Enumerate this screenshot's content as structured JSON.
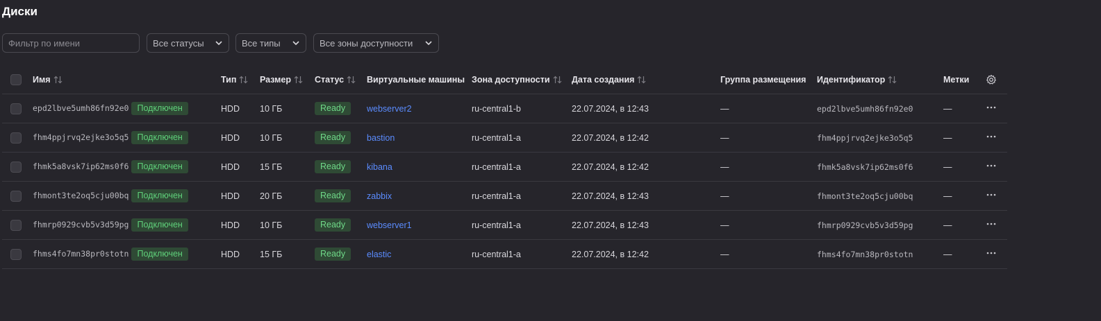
{
  "page": {
    "title": "Диски"
  },
  "filters": {
    "name_placeholder": "Фильтр по имени",
    "status_select": "Все статусы",
    "type_select": "Все типы",
    "zone_select": "Все зоны доступности"
  },
  "table": {
    "columns": {
      "name": "Имя",
      "type": "Тип",
      "size": "Размер",
      "status": "Статус",
      "vms": "Виртуальные машины",
      "zone": "Зона доступности",
      "created": "Дата создания",
      "placement": "Группа размещения",
      "id": "Идентификатор",
      "labels": "Метки"
    },
    "rows": [
      {
        "name": "epd2lbve5umh86fn92e0",
        "attach": "Подключен",
        "type": "HDD",
        "size": "10 ГБ",
        "status": "Ready",
        "vm": "webserver2",
        "zone": "ru-central1-b",
        "created": "22.07.2024, в 12:43",
        "placement": "—",
        "id": "epd2lbve5umh86fn92e0",
        "labels": "—"
      },
      {
        "name": "fhm4ppjrvq2ejke3o5q5",
        "attach": "Подключен",
        "type": "HDD",
        "size": "10 ГБ",
        "status": "Ready",
        "vm": "bastion",
        "zone": "ru-central1-a",
        "created": "22.07.2024, в 12:42",
        "placement": "—",
        "id": "fhm4ppjrvq2ejke3o5q5",
        "labels": "—"
      },
      {
        "name": "fhmk5a8vsk7ip62ms0f6",
        "attach": "Подключен",
        "type": "HDD",
        "size": "15 ГБ",
        "status": "Ready",
        "vm": "kibana",
        "zone": "ru-central1-a",
        "created": "22.07.2024, в 12:42",
        "placement": "—",
        "id": "fhmk5a8vsk7ip62ms0f6",
        "labels": "—"
      },
      {
        "name": "fhmont3te2oq5cju00bq",
        "attach": "Подключен",
        "type": "HDD",
        "size": "20 ГБ",
        "status": "Ready",
        "vm": "zabbix",
        "zone": "ru-central1-a",
        "created": "22.07.2024, в 12:43",
        "placement": "—",
        "id": "fhmont3te2oq5cju00bq",
        "labels": "—"
      },
      {
        "name": "fhmrp0929cvb5v3d59pg",
        "attach": "Подключен",
        "type": "HDD",
        "size": "10 ГБ",
        "status": "Ready",
        "vm": "webserver1",
        "zone": "ru-central1-a",
        "created": "22.07.2024, в 12:43",
        "placement": "—",
        "id": "fhmrp0929cvb5v3d59pg",
        "labels": "—"
      },
      {
        "name": "fhms4fo7mn38pr0stotn",
        "attach": "Подключен",
        "type": "HDD",
        "size": "15 ГБ",
        "status": "Ready",
        "vm": "elastic",
        "zone": "ru-central1-a",
        "created": "22.07.2024, в 12:42",
        "placement": "—",
        "id": "fhms4fo7mn38pr0stotn",
        "labels": "—"
      }
    ]
  },
  "colors": {
    "background": "#26252b",
    "connected_badge_bg": "#2f4a35",
    "connected_badge_text": "#5fd07a",
    "link": "#5b8cff"
  },
  "icons": {
    "sort": "sort-arrows-icon",
    "settings": "gear-icon",
    "row_menu": "more-dots-icon",
    "dropdown": "chevron-down-icon"
  }
}
